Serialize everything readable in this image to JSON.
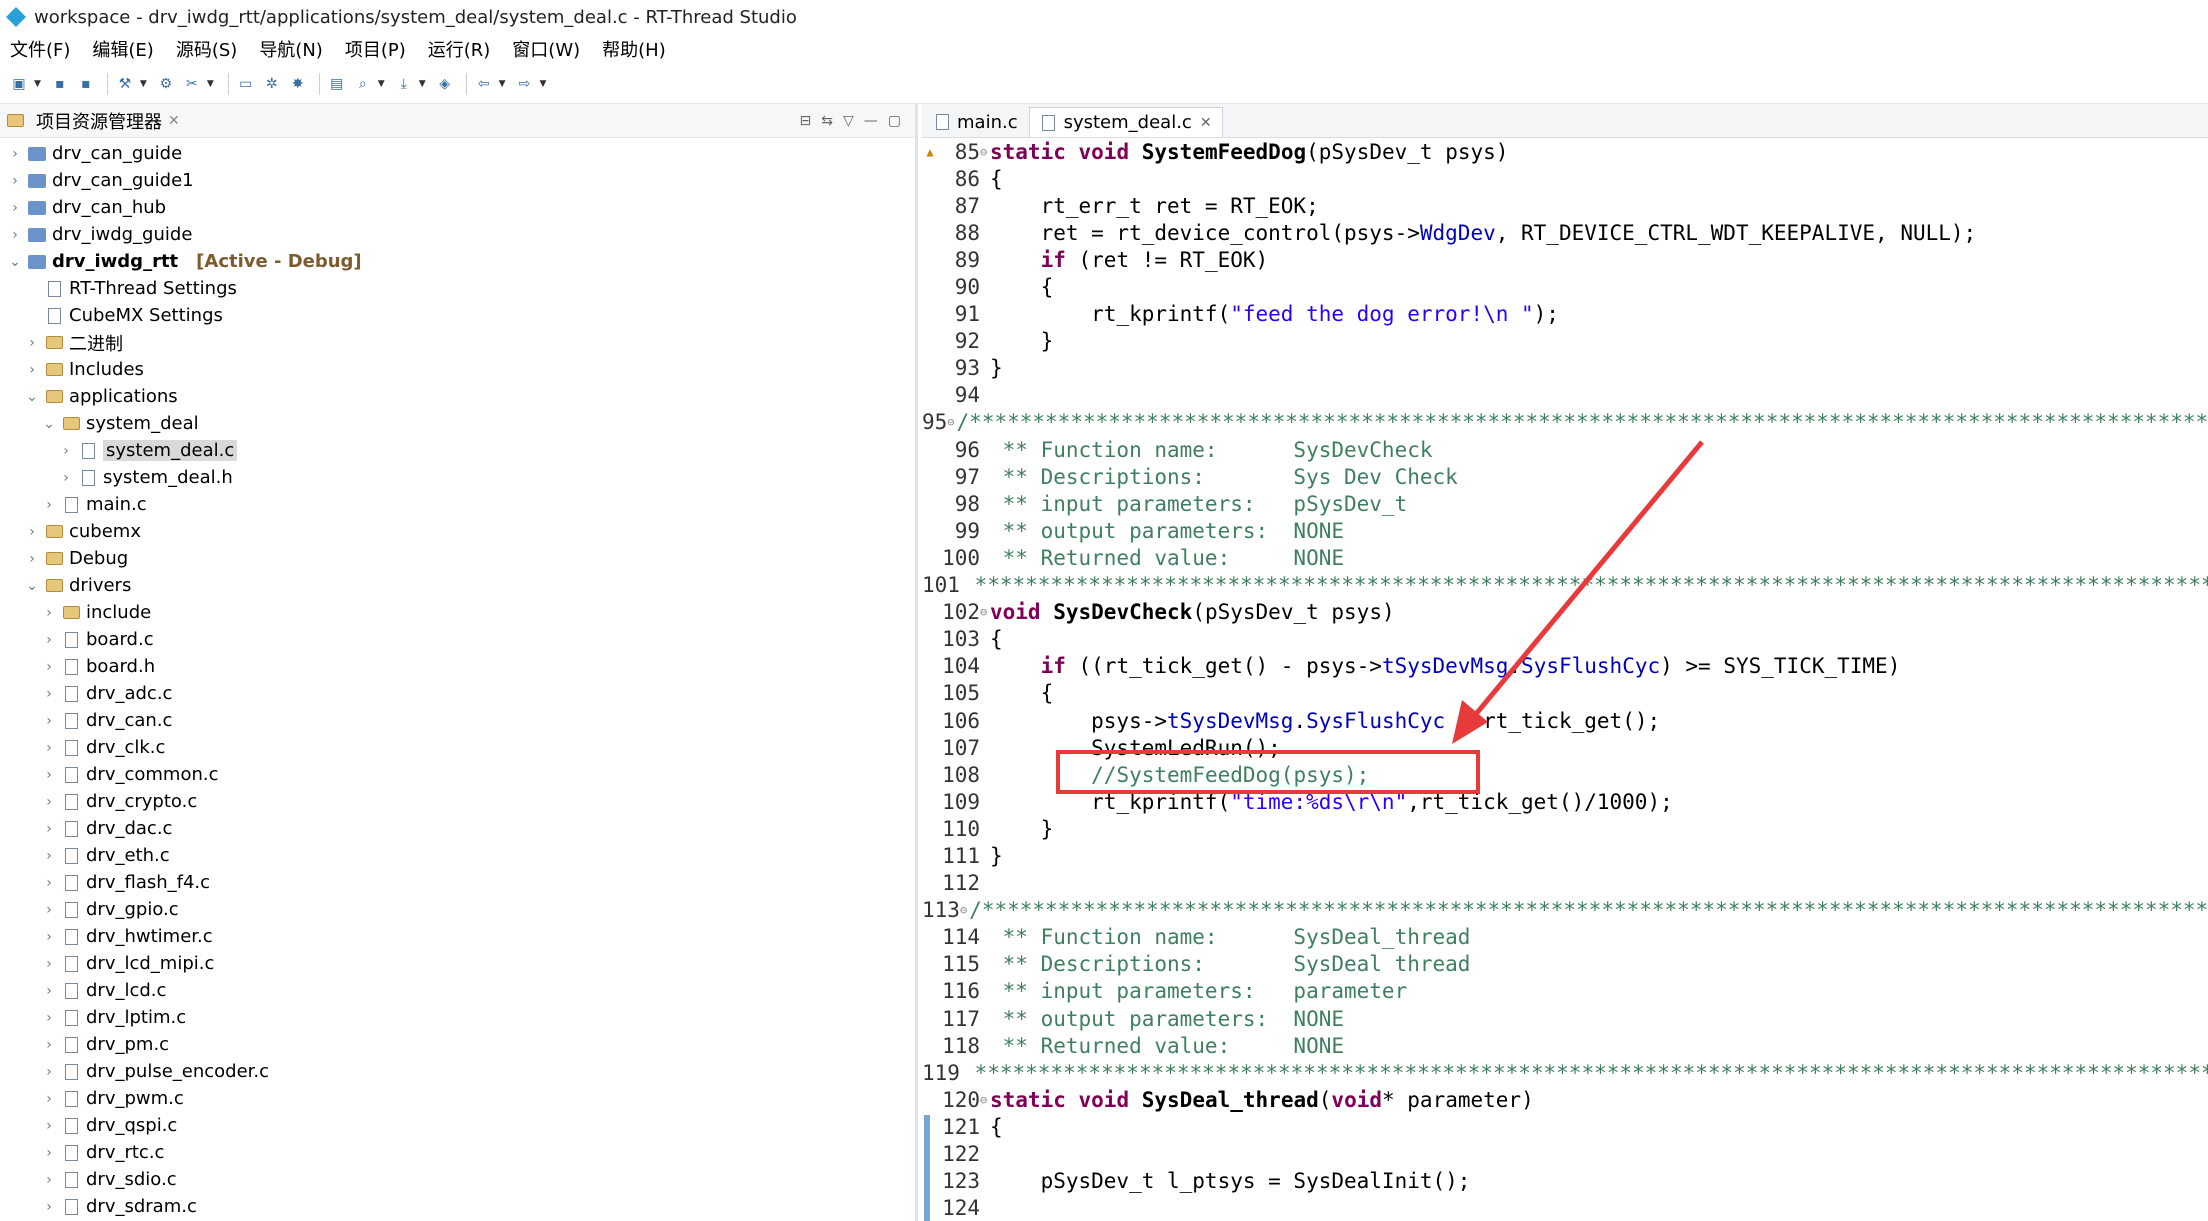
{
  "window": {
    "title": "workspace - drv_iwdg_rtt/applications/system_deal/system_deal.c - RT-Thread Studio"
  },
  "menu": [
    "文件(F)",
    "编辑(E)",
    "源码(S)",
    "导航(N)",
    "项目(P)",
    "运行(R)",
    "窗口(W)",
    "帮助(H)"
  ],
  "explorer": {
    "title": "项目资源管理器",
    "active_tag": "[Active - Debug]",
    "items": [
      {
        "label": "drv_can_guide",
        "depth": 0,
        "chev": "›",
        "icon": "project"
      },
      {
        "label": "drv_can_guide1",
        "depth": 0,
        "chev": "›",
        "icon": "project"
      },
      {
        "label": "drv_can_hub",
        "depth": 0,
        "chev": "›",
        "icon": "project"
      },
      {
        "label": "drv_iwdg_guide",
        "depth": 0,
        "chev": "›",
        "icon": "project"
      },
      {
        "label": "drv_iwdg_rtt",
        "depth": 0,
        "chev": "⌄",
        "icon": "project",
        "active": true
      },
      {
        "label": "RT-Thread Settings",
        "depth": 1,
        "chev": "",
        "icon": "file"
      },
      {
        "label": "CubeMX Settings",
        "depth": 1,
        "chev": "",
        "icon": "file"
      },
      {
        "label": "二进制",
        "depth": 1,
        "chev": "›",
        "icon": "folder"
      },
      {
        "label": "Includes",
        "depth": 1,
        "chev": "›",
        "icon": "folder"
      },
      {
        "label": "applications",
        "depth": 1,
        "chev": "⌄",
        "icon": "folder"
      },
      {
        "label": "system_deal",
        "depth": 2,
        "chev": "⌄",
        "icon": "folder"
      },
      {
        "label": "system_deal.c",
        "depth": 3,
        "chev": "›",
        "icon": "file",
        "selected": true
      },
      {
        "label": "system_deal.h",
        "depth": 3,
        "chev": "›",
        "icon": "file"
      },
      {
        "label": "main.c",
        "depth": 2,
        "chev": "›",
        "icon": "file"
      },
      {
        "label": "cubemx",
        "depth": 1,
        "chev": "›",
        "icon": "folder"
      },
      {
        "label": "Debug",
        "depth": 1,
        "chev": "›",
        "icon": "folder"
      },
      {
        "label": "drivers",
        "depth": 1,
        "chev": "⌄",
        "icon": "folder"
      },
      {
        "label": "include",
        "depth": 2,
        "chev": "›",
        "icon": "folder"
      },
      {
        "label": "board.c",
        "depth": 2,
        "chev": "›",
        "icon": "file"
      },
      {
        "label": "board.h",
        "depth": 2,
        "chev": "›",
        "icon": "file"
      },
      {
        "label": "drv_adc.c",
        "depth": 2,
        "chev": "›",
        "icon": "file"
      },
      {
        "label": "drv_can.c",
        "depth": 2,
        "chev": "›",
        "icon": "file"
      },
      {
        "label": "drv_clk.c",
        "depth": 2,
        "chev": "›",
        "icon": "file"
      },
      {
        "label": "drv_common.c",
        "depth": 2,
        "chev": "›",
        "icon": "file"
      },
      {
        "label": "drv_crypto.c",
        "depth": 2,
        "chev": "›",
        "icon": "file"
      },
      {
        "label": "drv_dac.c",
        "depth": 2,
        "chev": "›",
        "icon": "file"
      },
      {
        "label": "drv_eth.c",
        "depth": 2,
        "chev": "›",
        "icon": "file"
      },
      {
        "label": "drv_flash_f4.c",
        "depth": 2,
        "chev": "›",
        "icon": "file"
      },
      {
        "label": "drv_gpio.c",
        "depth": 2,
        "chev": "›",
        "icon": "file"
      },
      {
        "label": "drv_hwtimer.c",
        "depth": 2,
        "chev": "›",
        "icon": "file"
      },
      {
        "label": "drv_lcd_mipi.c",
        "depth": 2,
        "chev": "›",
        "icon": "file"
      },
      {
        "label": "drv_lcd.c",
        "depth": 2,
        "chev": "›",
        "icon": "file"
      },
      {
        "label": "drv_lptim.c",
        "depth": 2,
        "chev": "›",
        "icon": "file"
      },
      {
        "label": "drv_pm.c",
        "depth": 2,
        "chev": "›",
        "icon": "file"
      },
      {
        "label": "drv_pulse_encoder.c",
        "depth": 2,
        "chev": "›",
        "icon": "file"
      },
      {
        "label": "drv_pwm.c",
        "depth": 2,
        "chev": "›",
        "icon": "file"
      },
      {
        "label": "drv_qspi.c",
        "depth": 2,
        "chev": "›",
        "icon": "file"
      },
      {
        "label": "drv_rtc.c",
        "depth": 2,
        "chev": "›",
        "icon": "file"
      },
      {
        "label": "drv_sdio.c",
        "depth": 2,
        "chev": "›",
        "icon": "file"
      },
      {
        "label": "drv_sdram.c",
        "depth": 2,
        "chev": "›",
        "icon": "file"
      }
    ]
  },
  "editor": {
    "tabs": [
      {
        "label": "main.c",
        "active": false
      },
      {
        "label": "system_deal.c",
        "active": true
      }
    ],
    "lines": [
      {
        "n": "85",
        "fold": "⊖",
        "html": "<span class='kw'>static</span> <span class='kw'>void</span> <span class='fn'>SystemFeedDog</span>(pSysDev_t psys)"
      },
      {
        "n": "86",
        "html": "{"
      },
      {
        "n": "87",
        "html": "    rt_err_t ret = RT_EOK;"
      },
      {
        "n": "88",
        "html": "    ret = rt_device_control(psys-><span class='fld'>WdgDev</span>, RT_DEVICE_CTRL_WDT_KEEPALIVE, NULL);"
      },
      {
        "n": "89",
        "html": "    <span class='kw'>if</span> (ret != RT_EOK)"
      },
      {
        "n": "90",
        "html": "    {"
      },
      {
        "n": "91",
        "html": "        rt_kprintf(<span class='str'>\"feed the dog error!\\n \"</span>);"
      },
      {
        "n": "92",
        "html": "    }"
      },
      {
        "n": "93",
        "html": "}"
      },
      {
        "n": "94",
        "html": ""
      },
      {
        "n": "95",
        "fold": "⊖",
        "html": "<span class='cm'>/*****************************************************************************************************</span>"
      },
      {
        "n": "96",
        "html": "<span class='cm'> ** Function name:      SysDevCheck</span>"
      },
      {
        "n": "97",
        "html": "<span class='cm'> ** Descriptions:       Sys Dev Check</span>"
      },
      {
        "n": "98",
        "html": "<span class='cm'> ** input parameters:   pSysDev_t</span>"
      },
      {
        "n": "99",
        "html": "<span class='cm'> ** output parameters:  NONE</span>"
      },
      {
        "n": "100",
        "html": "<span class='cm'> ** Returned value:     NONE</span>"
      },
      {
        "n": "101",
        "html": "<span class='cm'> *****************************************************************************************************</span>"
      },
      {
        "n": "102",
        "fold": "⊖",
        "html": "<span class='kw'>void</span> <span class='fn'>SysDevCheck</span>(pSysDev_t psys)"
      },
      {
        "n": "103",
        "html": "{"
      },
      {
        "n": "104",
        "html": "    <span class='kw'>if</span> ((rt_tick_get() - psys-><span class='fld'>tSysDevMsg</span>.<span class='fld'>SysFlushCyc</span>) >= SYS_TICK_TIME)"
      },
      {
        "n": "105",
        "html": "    {"
      },
      {
        "n": "106",
        "html": "        psys-><span class='fld'>tSysDevMsg</span>.<span class='fld'>SysFlushCyc</span> = rt_tick_get();"
      },
      {
        "n": "107",
        "html": "        SystemLedRun();"
      },
      {
        "n": "108",
        "html": "        <span class='cm'>//SystemFeedDog(psys);</span>"
      },
      {
        "n": "109",
        "html": "        rt_kprintf(<span class='str'>\"time:%ds\\r\\n\"</span>,rt_tick_get()/1000);"
      },
      {
        "n": "110",
        "html": "    }"
      },
      {
        "n": "111",
        "html": "}"
      },
      {
        "n": "112",
        "html": ""
      },
      {
        "n": "113",
        "fold": "⊖",
        "html": "<span class='cm'>/*****************************************************************************************************</span>"
      },
      {
        "n": "114",
        "html": "<span class='cm'> ** Function name:      SysDeal_thread</span>"
      },
      {
        "n": "115",
        "html": "<span class='cm'> ** Descriptions:       SysDeal thread</span>"
      },
      {
        "n": "116",
        "html": "<span class='cm'> ** input parameters:   parameter</span>"
      },
      {
        "n": "117",
        "html": "<span class='cm'> ** output parameters:  NONE</span>"
      },
      {
        "n": "118",
        "html": "<span class='cm'> ** Returned value:     NONE</span>"
      },
      {
        "n": "119",
        "html": "<span class='cm'> *****************************************************************************************************</span>"
      },
      {
        "n": "120",
        "fold": "⊖",
        "html": "<span class='kw'>static</span> <span class='kw'>void</span> <span class='fn'>SysDeal_thread</span>(<span class='kw'>void</span>* parameter)"
      },
      {
        "n": "121",
        "html": "{"
      },
      {
        "n": "122",
        "html": ""
      },
      {
        "n": "123",
        "html": "    pSysDev_t l_ptsys = SysDealInit();"
      },
      {
        "n": "124",
        "html": ""
      }
    ]
  },
  "colors": {
    "annotation": "#e83a3a",
    "keyword": "#7f0055",
    "comment": "#3f7f5f",
    "string": "#2a00ff"
  }
}
